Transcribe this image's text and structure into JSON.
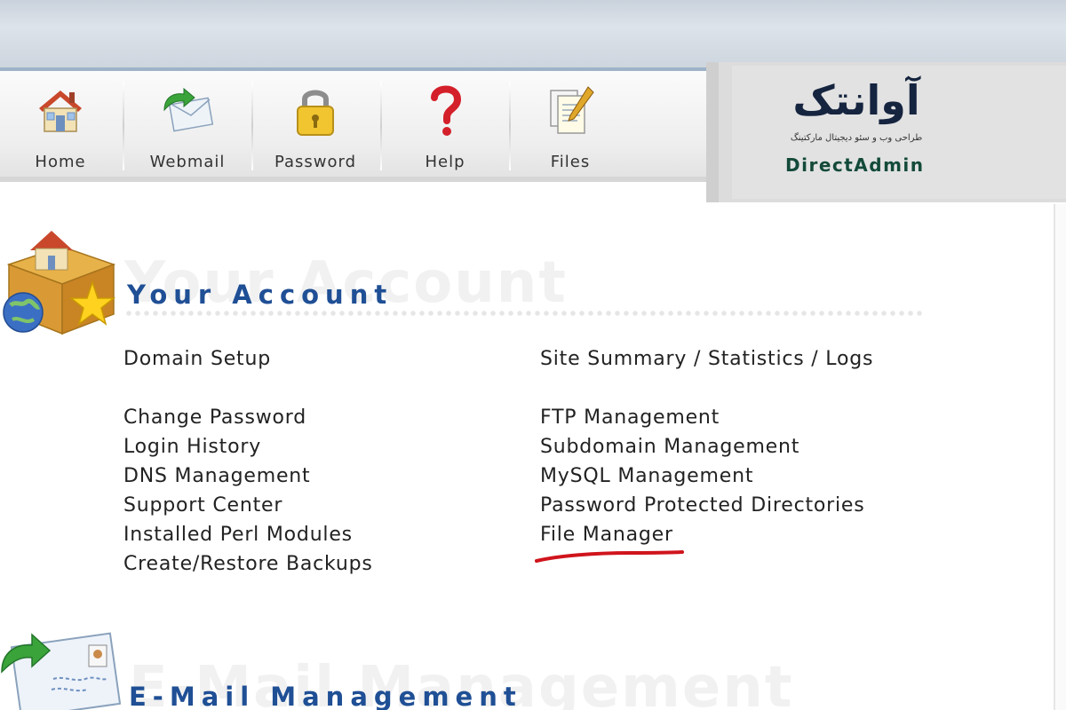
{
  "toolbar": {
    "items": [
      {
        "label": "Home",
        "icon": "house-icon"
      },
      {
        "label": "Webmail",
        "icon": "envelope-icon"
      },
      {
        "label": "Password",
        "icon": "padlock-icon"
      },
      {
        "label": "Help",
        "icon": "question-mark-icon"
      },
      {
        "label": "Files",
        "icon": "documents-icon"
      }
    ]
  },
  "brand": {
    "logo_text": "آوانتک",
    "tagline": "طراحی وب و سئو دیجیتال مارکتینگ",
    "product": "DirectAdmin"
  },
  "sections": {
    "account": {
      "title": "Your Account",
      "ghost": "Your Account",
      "left_links": [
        "Domain Setup",
        "Change Password",
        "Login History",
        "DNS Management",
        "Support Center",
        "Installed Perl Modules",
        "Create/Restore Backups"
      ],
      "right_links": [
        "Site Summary / Statistics / Logs",
        "FTP Management",
        "Subdomain Management",
        "MySQL Management",
        "Password Protected Directories",
        "File Manager"
      ]
    },
    "email": {
      "title": "E-Mail Management",
      "ghost": "E-Mail Management"
    }
  },
  "colors": {
    "section_title": "#1f4f95",
    "highlight_underline": "#d0141c",
    "brand_dark": "#15243f",
    "brand_green": "#134a3a"
  }
}
